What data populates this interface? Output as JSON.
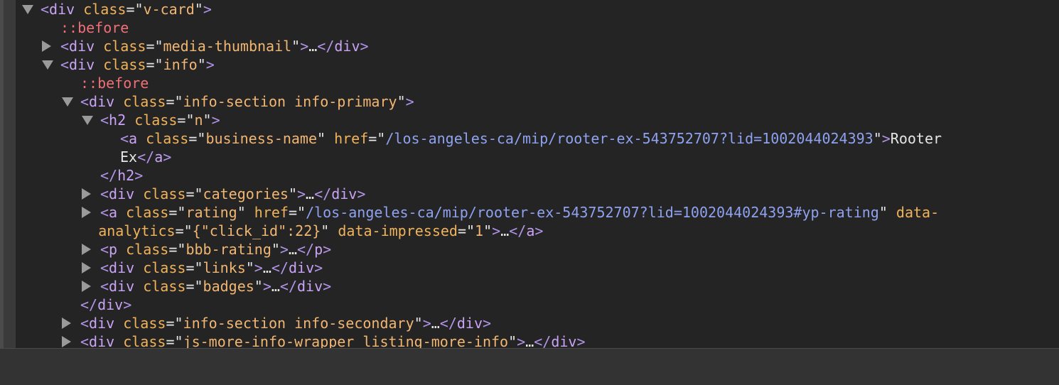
{
  "elements_tree": {
    "lines": [
      {
        "indent": 0,
        "toggle": "open",
        "parts": [
          {
            "c": "br",
            "t": "<"
          },
          {
            "c": "tagname",
            "t": "div"
          },
          {
            "c": "plain",
            "t": " "
          },
          {
            "c": "attr",
            "t": "class"
          },
          {
            "c": "plain",
            "t": "=\""
          },
          {
            "c": "val",
            "t": "v-card"
          },
          {
            "c": "plain",
            "t": "\""
          },
          {
            "c": "br",
            "t": ">"
          }
        ]
      },
      {
        "indent": 1,
        "toggle": "none",
        "parts": [
          {
            "c": "pseudo",
            "t": "::before"
          }
        ]
      },
      {
        "indent": 1,
        "toggle": "closed",
        "parts": [
          {
            "c": "br",
            "t": "<"
          },
          {
            "c": "tagname",
            "t": "div"
          },
          {
            "c": "plain",
            "t": " "
          },
          {
            "c": "attr",
            "t": "class"
          },
          {
            "c": "plain",
            "t": "=\""
          },
          {
            "c": "val",
            "t": "media-thumbnail"
          },
          {
            "c": "plain",
            "t": "\""
          },
          {
            "c": "br",
            "t": ">"
          },
          {
            "c": "ell",
            "t": "…"
          },
          {
            "c": "br",
            "t": "</"
          },
          {
            "c": "tagname",
            "t": "div"
          },
          {
            "c": "br",
            "t": ">"
          }
        ]
      },
      {
        "indent": 1,
        "toggle": "open",
        "parts": [
          {
            "c": "br",
            "t": "<"
          },
          {
            "c": "tagname",
            "t": "div"
          },
          {
            "c": "plain",
            "t": " "
          },
          {
            "c": "attr",
            "t": "class"
          },
          {
            "c": "plain",
            "t": "=\""
          },
          {
            "c": "val",
            "t": "info"
          },
          {
            "c": "plain",
            "t": "\""
          },
          {
            "c": "br",
            "t": ">"
          }
        ]
      },
      {
        "indent": 2,
        "toggle": "none",
        "parts": [
          {
            "c": "pseudo",
            "t": "::before"
          }
        ]
      },
      {
        "indent": 2,
        "toggle": "open",
        "parts": [
          {
            "c": "br",
            "t": "<"
          },
          {
            "c": "tagname",
            "t": "div"
          },
          {
            "c": "plain",
            "t": " "
          },
          {
            "c": "attr",
            "t": "class"
          },
          {
            "c": "plain",
            "t": "=\""
          },
          {
            "c": "val",
            "t": "info-section info-primary"
          },
          {
            "c": "plain",
            "t": "\""
          },
          {
            "c": "br",
            "t": ">"
          }
        ]
      },
      {
        "indent": 3,
        "toggle": "open",
        "parts": [
          {
            "c": "br",
            "t": "<"
          },
          {
            "c": "tagname",
            "t": "h2"
          },
          {
            "c": "plain",
            "t": " "
          },
          {
            "c": "attr",
            "t": "class"
          },
          {
            "c": "plain",
            "t": "=\""
          },
          {
            "c": "val",
            "t": "n"
          },
          {
            "c": "plain",
            "t": "\""
          },
          {
            "c": "br",
            "t": ">"
          }
        ]
      },
      {
        "indent": 4,
        "toggle": "none",
        "parts": [
          {
            "c": "br",
            "t": "<"
          },
          {
            "c": "tagname",
            "t": "a"
          },
          {
            "c": "plain",
            "t": " "
          },
          {
            "c": "attr",
            "t": "class"
          },
          {
            "c": "plain",
            "t": "=\""
          },
          {
            "c": "val",
            "t": "business-name"
          },
          {
            "c": "plain",
            "t": "\" "
          },
          {
            "c": "attr",
            "t": "href"
          },
          {
            "c": "plain",
            "t": "=\""
          },
          {
            "c": "url",
            "t": "/los-angeles-ca/mip/rooter-ex-543752707?lid=1002044024393"
          },
          {
            "c": "plain",
            "t": "\""
          },
          {
            "c": "br",
            "t": ">"
          },
          {
            "c": "plain",
            "t": "Rooter"
          }
        ]
      },
      {
        "indent": 4,
        "toggle": "none",
        "parts": [
          {
            "c": "plain",
            "t": "Ex"
          },
          {
            "c": "br",
            "t": "</"
          },
          {
            "c": "tagname",
            "t": "a"
          },
          {
            "c": "br",
            "t": ">"
          }
        ]
      },
      {
        "indent": 3,
        "toggle": "none",
        "parts": [
          {
            "c": "br",
            "t": "</"
          },
          {
            "c": "tagname",
            "t": "h2"
          },
          {
            "c": "br",
            "t": ">"
          }
        ]
      },
      {
        "indent": 3,
        "toggle": "closed",
        "parts": [
          {
            "c": "br",
            "t": "<"
          },
          {
            "c": "tagname",
            "t": "div"
          },
          {
            "c": "plain",
            "t": " "
          },
          {
            "c": "attr",
            "t": "class"
          },
          {
            "c": "plain",
            "t": "=\""
          },
          {
            "c": "val",
            "t": "categories"
          },
          {
            "c": "plain",
            "t": "\""
          },
          {
            "c": "br",
            "t": ">"
          },
          {
            "c": "ell",
            "t": "…"
          },
          {
            "c": "br",
            "t": "</"
          },
          {
            "c": "tagname",
            "t": "div"
          },
          {
            "c": "br",
            "t": ">"
          }
        ]
      },
      {
        "indent": 3,
        "toggle": "closed",
        "parts": [
          {
            "c": "br",
            "t": "<"
          },
          {
            "c": "tagname",
            "t": "a"
          },
          {
            "c": "plain",
            "t": " "
          },
          {
            "c": "attr",
            "t": "class"
          },
          {
            "c": "plain",
            "t": "=\""
          },
          {
            "c": "val",
            "t": "rating"
          },
          {
            "c": "plain",
            "t": "\" "
          },
          {
            "c": "attr",
            "t": "href"
          },
          {
            "c": "plain",
            "t": "=\""
          },
          {
            "c": "url",
            "t": "/los-angeles-ca/mip/rooter-ex-543752707?lid=1002044024393#yp-rating"
          },
          {
            "c": "plain",
            "t": "\" "
          },
          {
            "c": "attr",
            "t": "data-"
          }
        ]
      },
      {
        "indent": 2.9,
        "toggle": "none",
        "parts": [
          {
            "c": "attr",
            "t": "analytics"
          },
          {
            "c": "plain",
            "t": "=\""
          },
          {
            "c": "val",
            "t": "{\"click_id\":22}"
          },
          {
            "c": "plain",
            "t": "\" "
          },
          {
            "c": "attr",
            "t": "data-impressed"
          },
          {
            "c": "plain",
            "t": "=\""
          },
          {
            "c": "val",
            "t": "1"
          },
          {
            "c": "plain",
            "t": "\""
          },
          {
            "c": "br",
            "t": ">"
          },
          {
            "c": "ell",
            "t": "…"
          },
          {
            "c": "br",
            "t": "</"
          },
          {
            "c": "tagname",
            "t": "a"
          },
          {
            "c": "br",
            "t": ">"
          }
        ]
      },
      {
        "indent": 3,
        "toggle": "closed",
        "parts": [
          {
            "c": "br",
            "t": "<"
          },
          {
            "c": "tagname",
            "t": "p"
          },
          {
            "c": "plain",
            "t": " "
          },
          {
            "c": "attr",
            "t": "class"
          },
          {
            "c": "plain",
            "t": "=\""
          },
          {
            "c": "val",
            "t": "bbb-rating"
          },
          {
            "c": "plain",
            "t": "\""
          },
          {
            "c": "br",
            "t": ">"
          },
          {
            "c": "ell",
            "t": "…"
          },
          {
            "c": "br",
            "t": "</"
          },
          {
            "c": "tagname",
            "t": "p"
          },
          {
            "c": "br",
            "t": ">"
          }
        ]
      },
      {
        "indent": 3,
        "toggle": "closed",
        "parts": [
          {
            "c": "br",
            "t": "<"
          },
          {
            "c": "tagname",
            "t": "div"
          },
          {
            "c": "plain",
            "t": " "
          },
          {
            "c": "attr",
            "t": "class"
          },
          {
            "c": "plain",
            "t": "=\""
          },
          {
            "c": "val",
            "t": "links"
          },
          {
            "c": "plain",
            "t": "\""
          },
          {
            "c": "br",
            "t": ">"
          },
          {
            "c": "ell",
            "t": "…"
          },
          {
            "c": "br",
            "t": "</"
          },
          {
            "c": "tagname",
            "t": "div"
          },
          {
            "c": "br",
            "t": ">"
          }
        ]
      },
      {
        "indent": 3,
        "toggle": "closed",
        "parts": [
          {
            "c": "br",
            "t": "<"
          },
          {
            "c": "tagname",
            "t": "div"
          },
          {
            "c": "plain",
            "t": " "
          },
          {
            "c": "attr",
            "t": "class"
          },
          {
            "c": "plain",
            "t": "=\""
          },
          {
            "c": "val",
            "t": "badges"
          },
          {
            "c": "plain",
            "t": "\""
          },
          {
            "c": "br",
            "t": ">"
          },
          {
            "c": "ell",
            "t": "…"
          },
          {
            "c": "br",
            "t": "</"
          },
          {
            "c": "tagname",
            "t": "div"
          },
          {
            "c": "br",
            "t": ">"
          }
        ]
      },
      {
        "indent": 2,
        "toggle": "none",
        "parts": [
          {
            "c": "br",
            "t": "</"
          },
          {
            "c": "tagname",
            "t": "div"
          },
          {
            "c": "br",
            "t": ">"
          }
        ]
      },
      {
        "indent": 2,
        "toggle": "closed",
        "parts": [
          {
            "c": "br",
            "t": "<"
          },
          {
            "c": "tagname",
            "t": "div"
          },
          {
            "c": "plain",
            "t": " "
          },
          {
            "c": "attr",
            "t": "class"
          },
          {
            "c": "plain",
            "t": "=\""
          },
          {
            "c": "val",
            "t": "info-section info-secondary"
          },
          {
            "c": "plain",
            "t": "\""
          },
          {
            "c": "br",
            "t": ">"
          },
          {
            "c": "ell",
            "t": "…"
          },
          {
            "c": "br",
            "t": "</"
          },
          {
            "c": "tagname",
            "t": "div"
          },
          {
            "c": "br",
            "t": ">"
          }
        ]
      },
      {
        "indent": 2,
        "toggle": "closed",
        "parts": [
          {
            "c": "br",
            "t": "<"
          },
          {
            "c": "tagname",
            "t": "div"
          },
          {
            "c": "plain",
            "t": " "
          },
          {
            "c": "attr",
            "t": "class"
          },
          {
            "c": "plain",
            "t": "=\""
          },
          {
            "c": "val",
            "t": "js-more-info-wrapper listing-more-info"
          },
          {
            "c": "plain",
            "t": "\""
          },
          {
            "c": "br",
            "t": ">"
          },
          {
            "c": "ell",
            "t": "…"
          },
          {
            "c": "br",
            "t": "</"
          },
          {
            "c": "tagname",
            "t": "div"
          },
          {
            "c": "br",
            "t": ">"
          }
        ]
      }
    ]
  },
  "colors": {
    "background": "#242424",
    "gutter": "#3a3a3a",
    "bottom_pane": "#333333",
    "tag": "#c9a3f5",
    "attribute": "#f0b35a",
    "value": "#f2b673",
    "url": "#8fa2f0",
    "pseudo": "#ef6f76",
    "text": "#e6e6e6"
  }
}
